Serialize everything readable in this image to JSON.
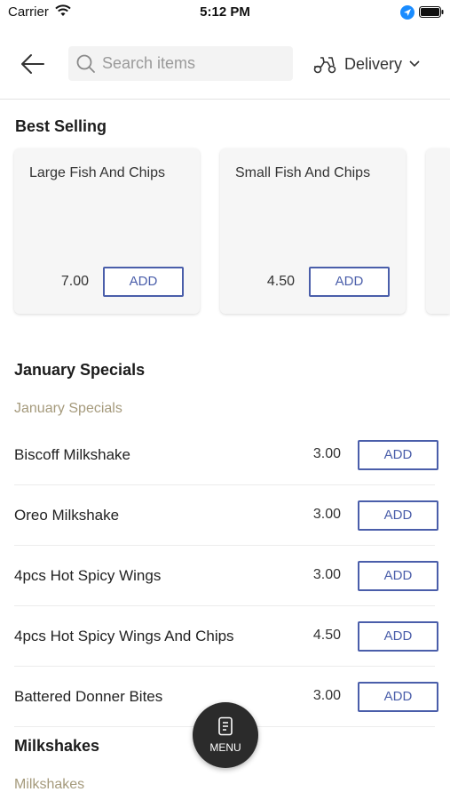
{
  "status_bar": {
    "carrier": "Carrier",
    "time": "5:12 PM",
    "icons": [
      "wifi-icon",
      "location-icon",
      "battery-icon"
    ]
  },
  "header": {
    "back_icon": "back-arrow-icon",
    "search_placeholder": "Search items",
    "search_value": "",
    "delivery_label": "Delivery",
    "delivery_icon": "scooter-icon"
  },
  "best_selling": {
    "title": "Best Selling",
    "items": [
      {
        "name": "Large Fish And Chips",
        "price": "7.00",
        "add_label": "ADD"
      },
      {
        "name": "Small Fish And Chips",
        "price": "4.50",
        "add_label": "ADD"
      }
    ]
  },
  "january_specials": {
    "title": "January Specials",
    "subtitle": "January Specials",
    "items": [
      {
        "name": "Biscoff Milkshake",
        "price": "3.00",
        "add_label": "ADD"
      },
      {
        "name": "Oreo Milkshake",
        "price": "3.00",
        "add_label": "ADD"
      },
      {
        "name": "4pcs Hot Spicy Wings",
        "price": "3.00",
        "add_label": "ADD"
      },
      {
        "name": "4pcs Hot Spicy Wings And Chips",
        "price": "4.50",
        "add_label": "ADD"
      },
      {
        "name": "Battered Donner Bites",
        "price": "3.00",
        "add_label": "ADD"
      }
    ]
  },
  "milkshakes": {
    "title": "Milkshakes",
    "subtitle": "Milkshakes"
  },
  "menu_button": {
    "label": "MENU"
  },
  "colors": {
    "accent": "#4a5eaa",
    "subtitle": "#a59a7c",
    "fab": "#2b2b2b",
    "location": "#1a8cff"
  }
}
